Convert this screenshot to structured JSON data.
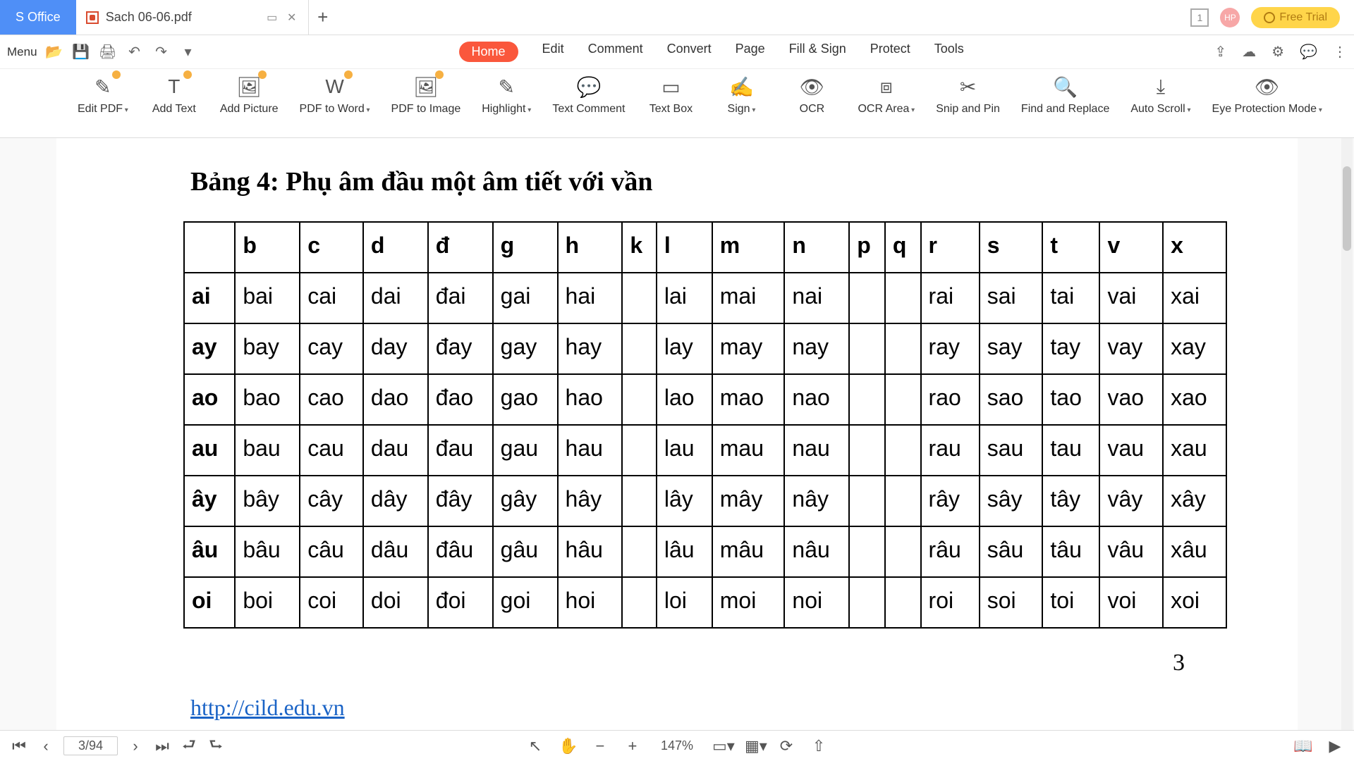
{
  "titlebar": {
    "office_label": "S Office",
    "doc_name": "Sach 06-06.pdf",
    "badge": "1",
    "avatar": "HP",
    "trial": "Free Trial"
  },
  "menubar": {
    "menu_label": "Menu",
    "tabs": [
      "Home",
      "Edit",
      "Comment",
      "Convert",
      "Page",
      "Fill & Sign",
      "Protect",
      "Tools"
    ],
    "active_index": 0
  },
  "ribbon": [
    {
      "label": "Edit PDF",
      "dd": true,
      "badge": true
    },
    {
      "label": "Add Text",
      "dd": false,
      "badge": true
    },
    {
      "label": "Add Picture",
      "dd": false,
      "badge": true
    },
    {
      "label": "PDF to Word",
      "dd": true,
      "badge": true
    },
    {
      "label": "PDF to Image",
      "dd": false,
      "badge": true
    },
    {
      "label": "Highlight",
      "dd": true,
      "badge": false
    },
    {
      "label": "Text Comment",
      "dd": false,
      "badge": false
    },
    {
      "label": "Text Box",
      "dd": false,
      "badge": false
    },
    {
      "label": "Sign",
      "dd": true,
      "badge": false
    },
    {
      "label": "OCR",
      "dd": false,
      "badge": false
    },
    {
      "label": "OCR Area",
      "dd": true,
      "badge": false
    },
    {
      "label": "Snip and Pin",
      "dd": false,
      "badge": false
    },
    {
      "label": "Find and Replace",
      "dd": false,
      "badge": false
    },
    {
      "label": "Auto Scroll",
      "dd": true,
      "badge": false
    },
    {
      "label": "Eye Protection Mode",
      "dd": true,
      "badge": false
    }
  ],
  "doc": {
    "title": "Bảng 4:   Phụ âm đầu một âm tiết với vần",
    "columns": [
      "",
      "b",
      "c",
      "d",
      "đ",
      "g",
      "h",
      "k",
      "l",
      "m",
      "n",
      "p",
      "q",
      "r",
      "s",
      "t",
      "v",
      "x"
    ],
    "rows": [
      {
        "hdr": "ai",
        "cells": [
          "bai",
          "cai",
          "dai",
          "đai",
          "gai",
          "hai",
          "",
          "lai",
          "mai",
          "nai",
          "",
          "",
          "rai",
          "sai",
          "tai",
          "vai",
          "xai"
        ]
      },
      {
        "hdr": "ay",
        "cells": [
          "bay",
          "cay",
          "day",
          "đay",
          "gay",
          "hay",
          "",
          "lay",
          "may",
          "nay",
          "",
          "",
          "ray",
          "say",
          "tay",
          "vay",
          "xay"
        ]
      },
      {
        "hdr": "ao",
        "cells": [
          "bao",
          "cao",
          "dao",
          "đao",
          "gao",
          "hao",
          "",
          "lao",
          "mao",
          "nao",
          "",
          "",
          "rao",
          "sao",
          "tao",
          "vao",
          "xao"
        ]
      },
      {
        "hdr": "au",
        "cells": [
          "bau",
          "cau",
          "dau",
          "đau",
          "gau",
          "hau",
          "",
          "lau",
          "mau",
          "nau",
          "",
          "",
          "rau",
          "sau",
          "tau",
          "vau",
          "xau"
        ]
      },
      {
        "hdr": "ây",
        "cells": [
          "bây",
          "cây",
          "dây",
          "đây",
          "gây",
          "hây",
          "",
          "lây",
          "mây",
          "nây",
          "",
          "",
          "rây",
          "sây",
          "tây",
          "vây",
          "xây"
        ]
      },
      {
        "hdr": "âu",
        "cells": [
          "bâu",
          "câu",
          "dâu",
          "đâu",
          "gâu",
          "hâu",
          "",
          "lâu",
          "mâu",
          "nâu",
          "",
          "",
          "râu",
          "sâu",
          "tâu",
          "vâu",
          "xâu"
        ]
      },
      {
        "hdr": "oi",
        "cells": [
          "boi",
          "coi",
          "doi",
          "đoi",
          "goi",
          "hoi",
          "",
          "loi",
          "moi",
          "noi",
          "",
          "",
          "roi",
          "soi",
          "toi",
          "voi",
          "xoi"
        ]
      }
    ],
    "page_number": "3",
    "source_url": "http://cild.edu.vn"
  },
  "status": {
    "page_indicator": "3/94",
    "zoom": "147%"
  }
}
